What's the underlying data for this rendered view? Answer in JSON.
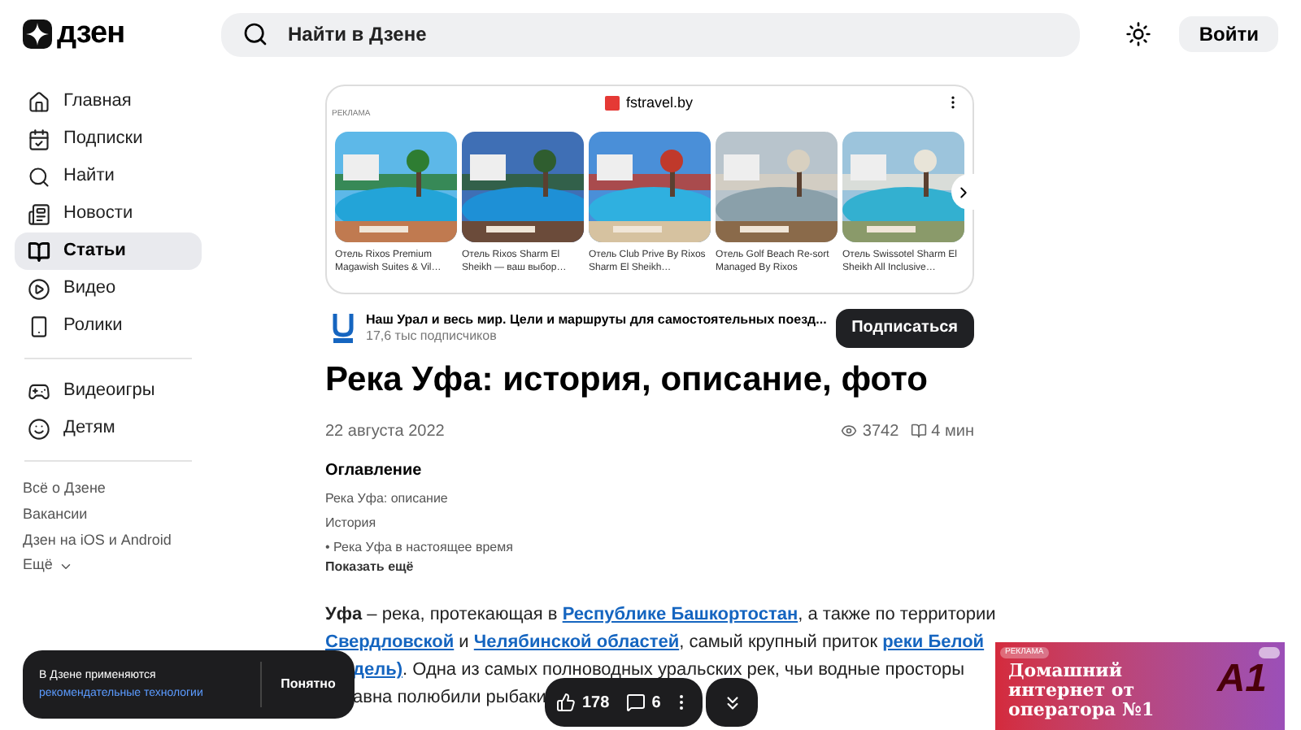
{
  "header": {
    "logo": "дзен",
    "search": {
      "placeholder": "Найти в Дзене"
    },
    "login": "Войти"
  },
  "sidebar": {
    "items": [
      {
        "label": "Главная",
        "selected": false
      },
      {
        "label": "Подписки",
        "selected": false
      },
      {
        "label": "Найти",
        "selected": false
      },
      {
        "label": "Новости",
        "selected": false
      },
      {
        "label": "Статьи",
        "selected": true
      },
      {
        "label": "Видео",
        "selected": false
      },
      {
        "label": "Ролики",
        "selected": false
      }
    ],
    "items_2": [
      {
        "label": "Видеоигры",
        "selected": false
      },
      {
        "label": "Детям",
        "selected": false
      }
    ],
    "links": [
      "Всё о Дзене",
      "Вакансии",
      "Дзен на iOS и Android"
    ],
    "more": "Ещё"
  },
  "ad": {
    "badge": "РЕКЛАМА",
    "source": "fstravel.by",
    "cards": [
      {
        "caption": "Отель Rixos Premium Magawish Suites & Vil…"
      },
      {
        "caption": "Отель Rixos Sharm El Sheikh — ваш выбор…"
      },
      {
        "caption": "Отель Club Prive By Rixos Sharm El Sheikh…"
      },
      {
        "caption": "Отель Golf Beach Re-sort Managed By Rixos"
      },
      {
        "caption": "Отель Swissotel Sharm El Sheikh All Inclusive…"
      }
    ]
  },
  "channel": {
    "name": "Наш Урал и весь мир. Цели и маршруты для самостоятельных поезд...",
    "subscribers": "17,6 тыс подписчиков",
    "subscribe": "Подписаться"
  },
  "article": {
    "title": "Река Уфа: история, описание, фото",
    "date": "22 августа 2022",
    "views": "3742",
    "read_time": "4 мин",
    "toc": {
      "title": "Оглавление",
      "items": [
        "Река Уфа: описание",
        "История",
        "• Река Уфа в настоящее время"
      ],
      "more": "Показать ещё"
    },
    "lines": [
      [
        {
          "kind": "bold",
          "text": "Уфа"
        },
        {
          "kind": "plain",
          "text": " – река, протекающая в "
        },
        {
          "kind": "link",
          "text": "Республике Башкортостан"
        },
        {
          "kind": "plain",
          "text": ", а также по территории"
        }
      ],
      [
        {
          "kind": "link",
          "text": "Свердловской"
        },
        {
          "kind": "plain",
          "text": " и "
        },
        {
          "kind": "link",
          "text": "Челябинской областей"
        },
        {
          "kind": "plain",
          "text": ", самый крупный приток "
        },
        {
          "kind": "link",
          "text": "реки Белой"
        }
      ]
    ],
    "covered_lines": [
      [
        {
          "kind": "link",
          "text": "дель)"
        },
        {
          "kind": "plain",
          "text": ". Одна из самых полноводных уральских рек, чьи водные просторы"
        }
      ],
      [
        {
          "kind": "plain",
          "text": "авна полюбили рыбаки"
        }
      ]
    ]
  },
  "actions": {
    "likes": "178",
    "comments": "6"
  },
  "cookie": {
    "text": "В Дзене применяются",
    "link": "рекомендательные технологии",
    "button": "Понятно"
  },
  "side_ad": {
    "badge": "РЕКЛАМА",
    "text": "Домашний интернет от оператора №1",
    "logo": "A1"
  }
}
